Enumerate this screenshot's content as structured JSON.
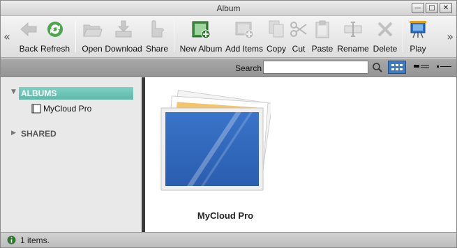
{
  "window": {
    "title": "Album",
    "controls": [
      "minimize",
      "maximize",
      "close"
    ]
  },
  "toolbar": {
    "scroll_left_icon": "double-chevron-left",
    "scroll_right_icon": "double-chevron-right",
    "buttons": [
      {
        "label": "Back",
        "icon": "back-arrow-icon",
        "enabled": false
      },
      {
        "label": "Refresh",
        "icon": "refresh-icon",
        "enabled": true
      },
      {
        "label": "Open",
        "icon": "open-folder-icon",
        "enabled": false
      },
      {
        "label": "Download",
        "icon": "download-icon",
        "enabled": false
      },
      {
        "label": "Share",
        "icon": "share-icon",
        "enabled": false
      },
      {
        "label": "New Album",
        "icon": "new-album-icon",
        "enabled": true
      },
      {
        "label": "Add Items",
        "icon": "add-items-icon",
        "enabled": false
      },
      {
        "label": "Copy",
        "icon": "copy-icon",
        "enabled": false
      },
      {
        "label": "Cut",
        "icon": "cut-icon",
        "enabled": false
      },
      {
        "label": "Paste",
        "icon": "paste-icon",
        "enabled": false
      },
      {
        "label": "Rename",
        "icon": "rename-icon",
        "enabled": false
      },
      {
        "label": "Delete",
        "icon": "delete-icon",
        "enabled": false
      },
      {
        "label": "Play",
        "icon": "play-slideshow-icon",
        "enabled": true
      }
    ]
  },
  "search": {
    "label": "Search",
    "value": "",
    "placeholder": ""
  },
  "view_modes": [
    {
      "name": "grid",
      "selected": true
    },
    {
      "name": "list",
      "selected": false
    },
    {
      "name": "detail",
      "selected": false
    }
  ],
  "sidebar": {
    "sections": [
      {
        "label": "ALBUMS",
        "expanded": true,
        "items": [
          {
            "label": "MyCloud Pro"
          }
        ]
      },
      {
        "label": "SHARED",
        "expanded": false,
        "items": []
      }
    ]
  },
  "content": {
    "items": [
      {
        "label": "MyCloud Pro",
        "type": "album"
      }
    ]
  },
  "status": {
    "text": "1 items.",
    "icon": "info-icon"
  },
  "colors": {
    "selection": "#6cc3b6",
    "accent": "#3c7ac4",
    "splitter": "#3a3a3a"
  }
}
